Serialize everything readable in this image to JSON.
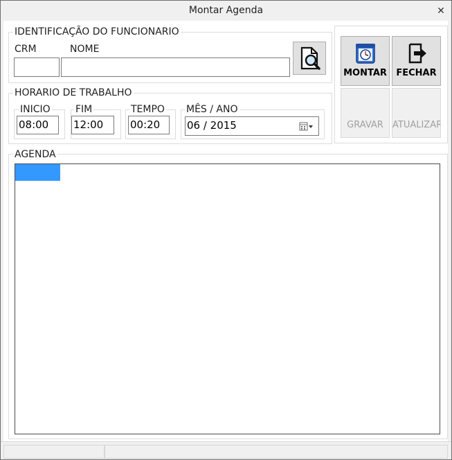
{
  "window": {
    "title": "Montar Agenda",
    "close_glyph": "✕"
  },
  "identificacao": {
    "group_label": "IDENTIFICAÇÃO DO FUNCIONARIO",
    "crm_label": "CRM",
    "crm_value": "",
    "nome_label": "NOME",
    "nome_value": "",
    "search_icon": "document-search-icon"
  },
  "horario": {
    "group_label": "HORARIO DE TRABALHO",
    "inicio_label": "INICIO",
    "inicio_value": "08:00",
    "fim_label": "FIM",
    "fim_value": "12:00",
    "tempo_label": "TEMPO",
    "tempo_value": "00:20",
    "mes_ano_label": "MÊS / ANO",
    "mes_ano_value": "06 / 2015",
    "calendar_icon": "calendar-dropdown-icon"
  },
  "actions": {
    "montar_label": "MONTAR",
    "montar_icon": "calendar-clock-icon",
    "fechar_label": "FECHAR",
    "fechar_icon": "exit-icon",
    "gravar_label": "GRAVAR",
    "atualizar_label": "ATUALIZAR"
  },
  "agenda": {
    "group_label": "AGENDA",
    "selected_color": "#3399ff"
  },
  "statusbar": {
    "panels": [
      "",
      ""
    ]
  }
}
